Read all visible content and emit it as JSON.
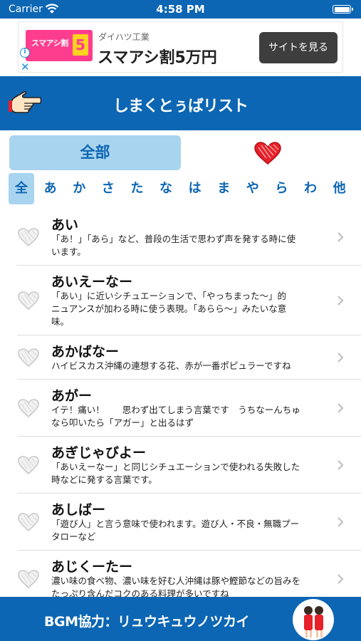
{
  "status_bar": {
    "carrier": "Carrier",
    "time": "4:58 PM"
  },
  "ad": {
    "image_text": "スマアシ割",
    "image_badge": "5",
    "sponsor": "ダイハツ工業",
    "headline": "スマアシ割5万円",
    "cta": "サイトを見る",
    "info_icon": "i",
    "close_icon": "✕"
  },
  "header": {
    "title": "しまくとぅばリスト",
    "icon": "pointing-hand-icon"
  },
  "tabs": {
    "all_label": "全部",
    "favorites_icon": "heart-icon",
    "favorites_color": "#e8202a"
  },
  "kana_index": [
    "全",
    "あ",
    "か",
    "さ",
    "た",
    "な",
    "は",
    "ま",
    "や",
    "ら",
    "わ",
    "他"
  ],
  "words": [
    {
      "term": "あい",
      "desc": [
        "「あ！」「あら」など、普段の生活で思わず声を発する時に使",
        "います。"
      ]
    },
    {
      "term": "あいえーなー",
      "desc": [
        "「あい」に近いシチュエーションで、「やっちまった〜」的",
        "ニュアンスが加わる時に使う表現。「あらら〜」みたいな意",
        "味。"
      ]
    },
    {
      "term": "あかばなー",
      "desc": [
        "ハイビスカス沖縄の連想する花、赤が一番ポピュラーですね"
      ]
    },
    {
      "term": "あがー",
      "desc": [
        "イテ！痛い！　　思わず出てしまう言葉です　うちなーんちゅ",
        "なら叩いたら「アガー」と出るはず"
      ]
    },
    {
      "term": "あぎじゃびよー",
      "desc": [
        "「あいえーなー」と同じシチュエーションで使われる失敗した",
        "時などに発する言葉です。"
      ]
    },
    {
      "term": "あしばー",
      "desc": [
        "「遊び人」と言う意味で使われます。遊び人・不良・無職プー",
        "タローなど"
      ]
    },
    {
      "term": "あじくーたー",
      "desc": [
        "濃い味の食べ物、濃い味を好む人沖縄は豚や鰹節などの旨みを",
        "たっぷり含んだコクのある料理が多いですね"
      ]
    }
  ],
  "footer": {
    "credit": "BGM協力：リュウキュウノツカイ"
  },
  "colors": {
    "primary": "#0c66b3",
    "tab_selected": "#a9d4ef",
    "heart_outline": "#c8c8c8"
  }
}
